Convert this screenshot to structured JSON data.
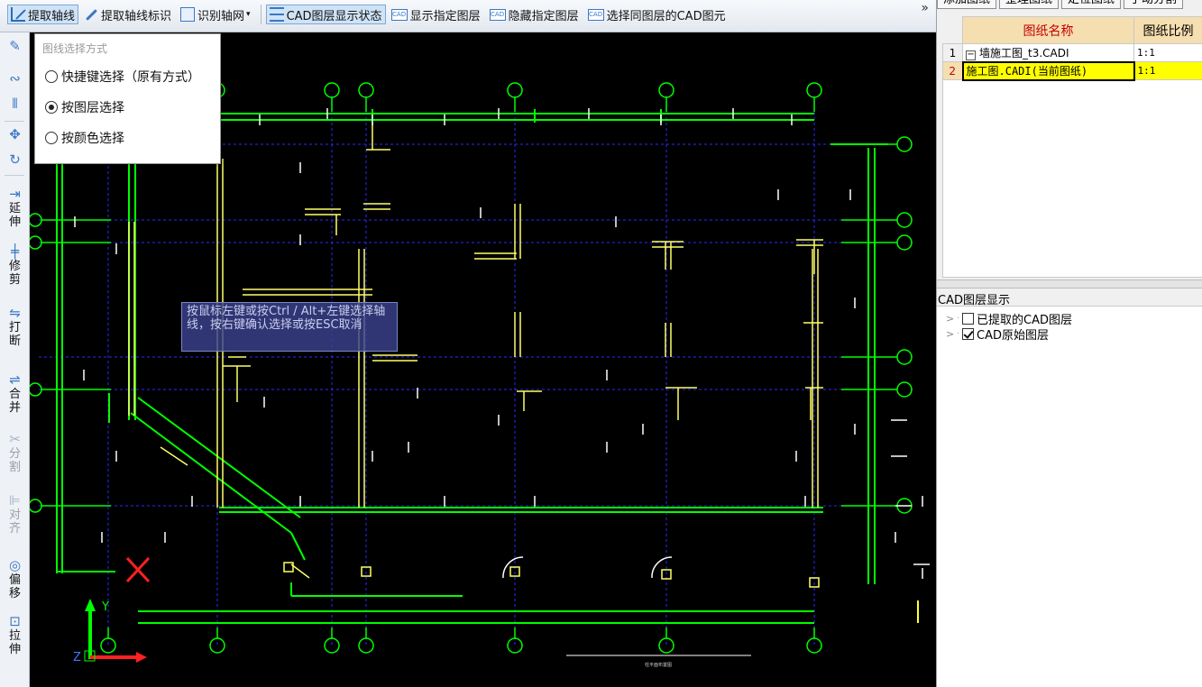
{
  "toolbar": {
    "extract_axis": "提取轴线",
    "extract_axis_mark": "提取轴线标识",
    "recognize_grid": "识别轴网",
    "cad_layer_state": "CAD图层显示状态",
    "show_layer": "显示指定图层",
    "hide_layer": "隐藏指定图层",
    "select_same_layer": "选择同图层的CAD图元",
    "cad_icon_text": "CAD",
    "more": "»"
  },
  "left_toolbar": [
    {
      "label": "",
      "icon": "brush-icon"
    },
    {
      "label": "",
      "icon": "link-icon"
    },
    {
      "label": "",
      "icon": "mirror-icon"
    },
    {
      "label": "",
      "icon": "move-icon"
    },
    {
      "label": "",
      "icon": "rotate-icon"
    },
    {
      "label": "延伸",
      "icon": "extend-icon"
    },
    {
      "label": "修剪",
      "icon": "trim-icon"
    },
    {
      "label": "打断",
      "icon": "break-icon"
    },
    {
      "label": "合并",
      "icon": "merge-icon"
    },
    {
      "label": "分割",
      "icon": "split-icon"
    },
    {
      "label": "对齐",
      "icon": "align-icon"
    },
    {
      "label": "偏移",
      "icon": "offset-icon"
    },
    {
      "label": "拉伸",
      "icon": "stretch-icon"
    }
  ],
  "popup": {
    "title": "图线选择方式",
    "options": [
      {
        "label": "快捷键选择（原有方式）",
        "selected": false
      },
      {
        "label": "按图层选择",
        "selected": true
      },
      {
        "label": "按颜色选择",
        "selected": false
      }
    ]
  },
  "tooltip": "按鼠标左键或按Ctrl / Alt+左键选择轴线，按右键确认选择或按ESC取消",
  "canvas": {
    "axis_y": "Y",
    "axis_z": "Z",
    "bottom_caption": "柱平面布置图"
  },
  "right_panel": {
    "tabs": [
      "添加图纸",
      "整理图纸",
      "定位图纸",
      "手动分割"
    ],
    "table": {
      "headers": [
        "图纸名称",
        "图纸比例"
      ],
      "rows": [
        {
          "num": "1",
          "name": "墙施工图_t3.CADI",
          "scale": "1:1",
          "selected": false
        },
        {
          "num": "2",
          "name": "施工图.CADI(当前图纸)",
          "scale": "1:1",
          "selected": true
        }
      ]
    },
    "layer_panel_title": "CAD图层显示",
    "layers": [
      {
        "label": "已提取的CAD图层",
        "checked": false
      },
      {
        "label": "CAD原始图层",
        "checked": true
      }
    ]
  },
  "colors": {
    "canvas_bg": "#000000",
    "wall_green": "#00ff00",
    "column_yellow": "#ffff66",
    "axis_blue": "#2a2aff",
    "selection_yellow": "#ffff00",
    "header_tan": "#f5deb0",
    "cross_red": "#ff2020"
  }
}
